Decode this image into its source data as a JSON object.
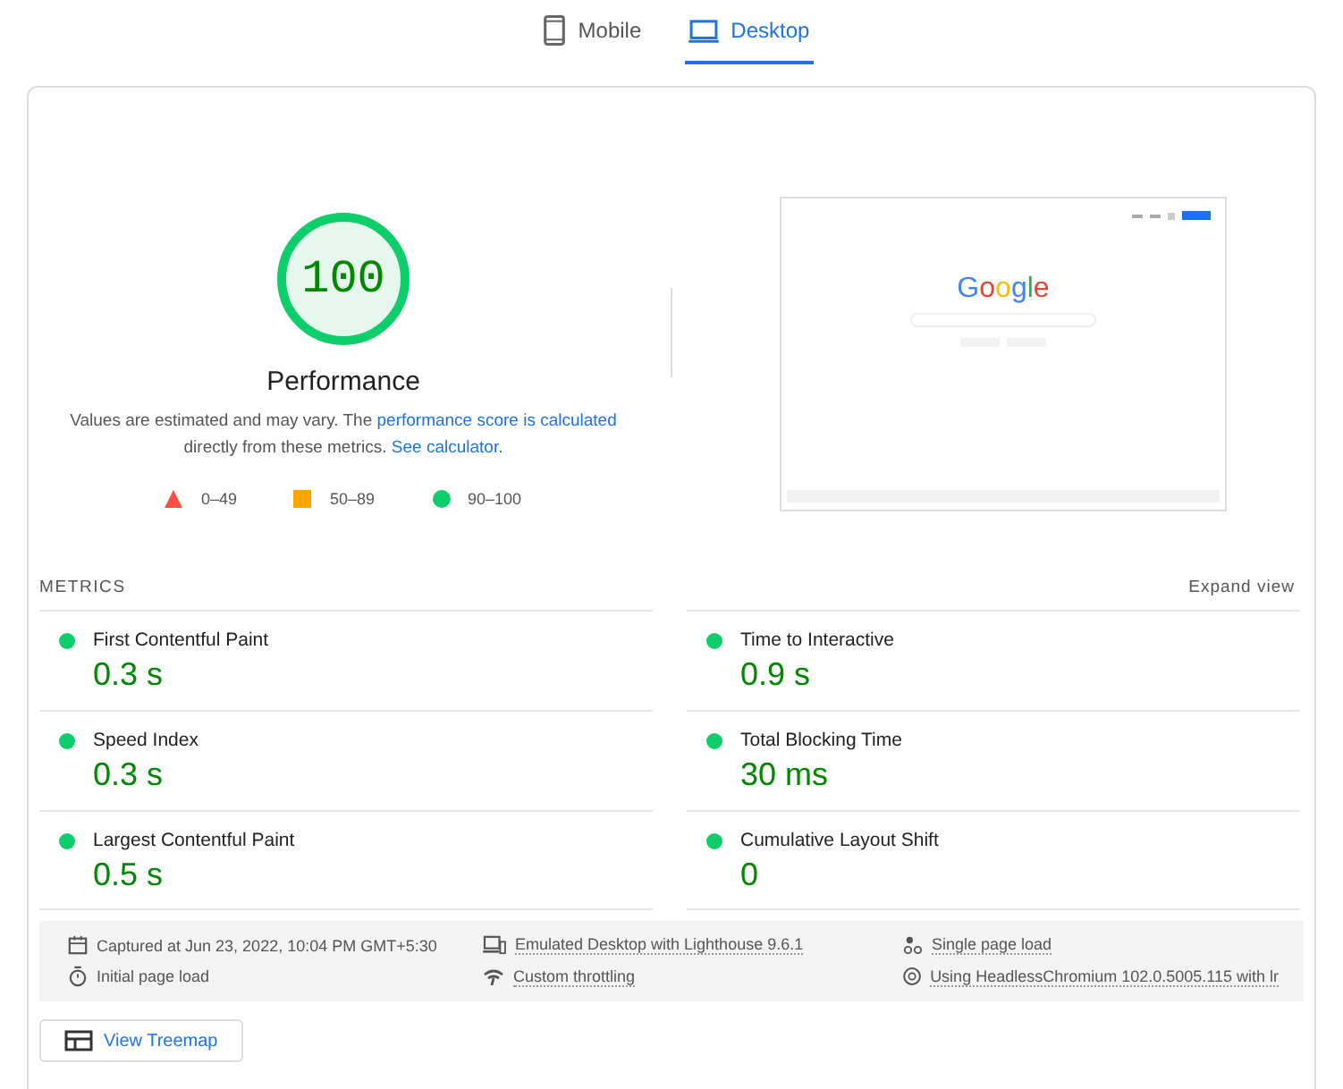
{
  "tabs": [
    {
      "label": "Mobile",
      "kind": "phone",
      "selected": false
    },
    {
      "label": "Desktop",
      "kind": "monitor",
      "selected": true
    }
  ],
  "gauge": {
    "score": "100",
    "title": "Performance"
  },
  "note": {
    "before": "Values are estimated and may vary. The ",
    "link1": "performance score is calculated",
    "middle": " directly from these metrics. ",
    "link2": "See calculator."
  },
  "legend": [
    {
      "kind": "fail",
      "label": "0–49"
    },
    {
      "kind": "average",
      "label": "50–89"
    },
    {
      "kind": "pass",
      "label": "90–100"
    }
  ],
  "thumbnail": {
    "logo": "Google"
  },
  "metrics_header": {
    "title": "METRICS",
    "toggle": "Expand view"
  },
  "metrics": [
    {
      "name": "First Contentful Paint",
      "value": "0.3 s"
    },
    {
      "name": "Time to Interactive",
      "value": "0.9 s"
    },
    {
      "name": "Speed Index",
      "value": "0.3 s"
    },
    {
      "name": "Total Blocking Time",
      "value": "30 ms"
    },
    {
      "name": "Largest Contentful Paint",
      "value": "0.5 s"
    },
    {
      "name": "Cumulative Layout Shift",
      "value": "0"
    }
  ],
  "runtime": [
    {
      "kind": "calendar",
      "text": "Captured at Jun 23, 2022, 10:04 PM GMT+5:30",
      "dotted": false
    },
    {
      "kind": "devices",
      "text": "Emulated Desktop with Lighthouse 9.6.1",
      "dotted": true
    },
    {
      "kind": "nodes",
      "text": "Single page load",
      "dotted": true
    },
    {
      "kind": "timer",
      "text": "Initial page load",
      "dotted": false
    },
    {
      "kind": "wifi",
      "text": "Custom throttling",
      "dotted": true
    },
    {
      "kind": "chrome",
      "text": "Using HeadlessChromium 102.0.5005.115 with lr",
      "dotted": true
    }
  ],
  "treemap_button": {
    "label": "View Treemap"
  }
}
